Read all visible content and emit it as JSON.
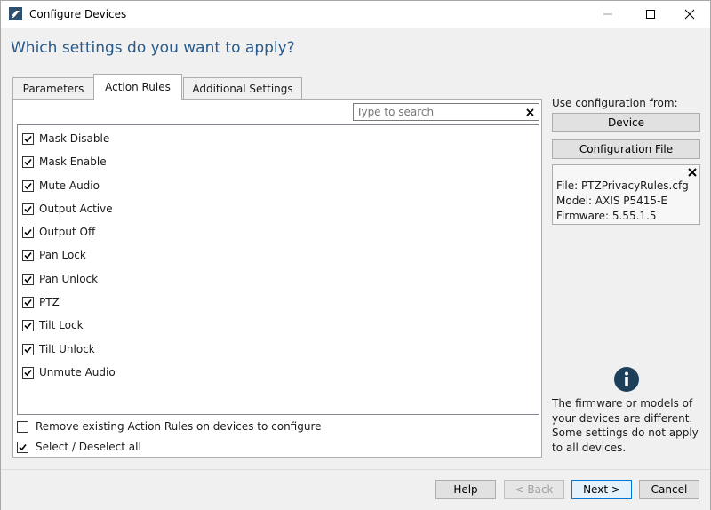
{
  "window": {
    "title": "Configure Devices",
    "heading": "Which settings do you want to apply?"
  },
  "tabs": [
    {
      "label": "Parameters",
      "active": false
    },
    {
      "label": "Action Rules",
      "active": true
    },
    {
      "label": "Additional Settings",
      "active": false
    }
  ],
  "search": {
    "placeholder": "Type to search",
    "value": ""
  },
  "action_rules": [
    {
      "label": "Mask Disable",
      "checked": true
    },
    {
      "label": "Mask Enable",
      "checked": true
    },
    {
      "label": "Mute Audio",
      "checked": true
    },
    {
      "label": "Output Active",
      "checked": true
    },
    {
      "label": "Output Off",
      "checked": true
    },
    {
      "label": "Pan Lock",
      "checked": true
    },
    {
      "label": "Pan Unlock",
      "checked": true
    },
    {
      "label": "PTZ",
      "checked": true
    },
    {
      "label": "Tilt Lock",
      "checked": true
    },
    {
      "label": "Tilt Unlock",
      "checked": true
    },
    {
      "label": "Unmute Audio",
      "checked": true
    }
  ],
  "options": {
    "remove_existing": {
      "label": "Remove existing Action Rules on devices to configure",
      "checked": false
    },
    "select_all": {
      "label": "Select / Deselect all",
      "checked": true
    }
  },
  "sidebar": {
    "use_config_label": "Use configuration from:",
    "device_button": "Device",
    "config_file_button": "Configuration File",
    "file_line": "File: PTZPrivacyRules.cfg",
    "model_line": "Model: AXIS P5415-E",
    "firmware_line": "Firmware: 5.55.1.5",
    "warning_text": "The firmware or models of your devices are different. Some settings do not apply to all devices."
  },
  "footer": {
    "help": "Help",
    "back": "< Back",
    "next": "Next >",
    "cancel": "Cancel"
  },
  "colors": {
    "heading": "#2a5a8a",
    "accent_border": "#0078d7",
    "info_icon": "#1e3f5a"
  }
}
